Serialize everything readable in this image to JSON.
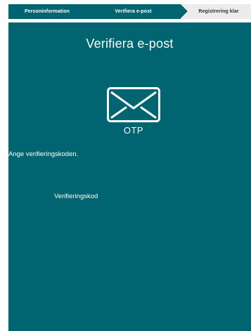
{
  "stepper": {
    "steps": [
      {
        "label": "Personinformation",
        "state": "completed"
      },
      {
        "label": "Verifiera e-post",
        "state": "active"
      },
      {
        "label": "Registrering klar",
        "state": "upcoming"
      }
    ]
  },
  "main": {
    "title": "Verifiera e-post",
    "icon": "envelope-icon",
    "icon_caption": "OTP",
    "instruction": "Ange verifieringskoden.",
    "code_field": {
      "label": "Verifieringskod",
      "value": ""
    }
  },
  "colors": {
    "brand": "#006570",
    "upcoming_step": "#ececec",
    "text_on_brand": "#ffffff"
  }
}
